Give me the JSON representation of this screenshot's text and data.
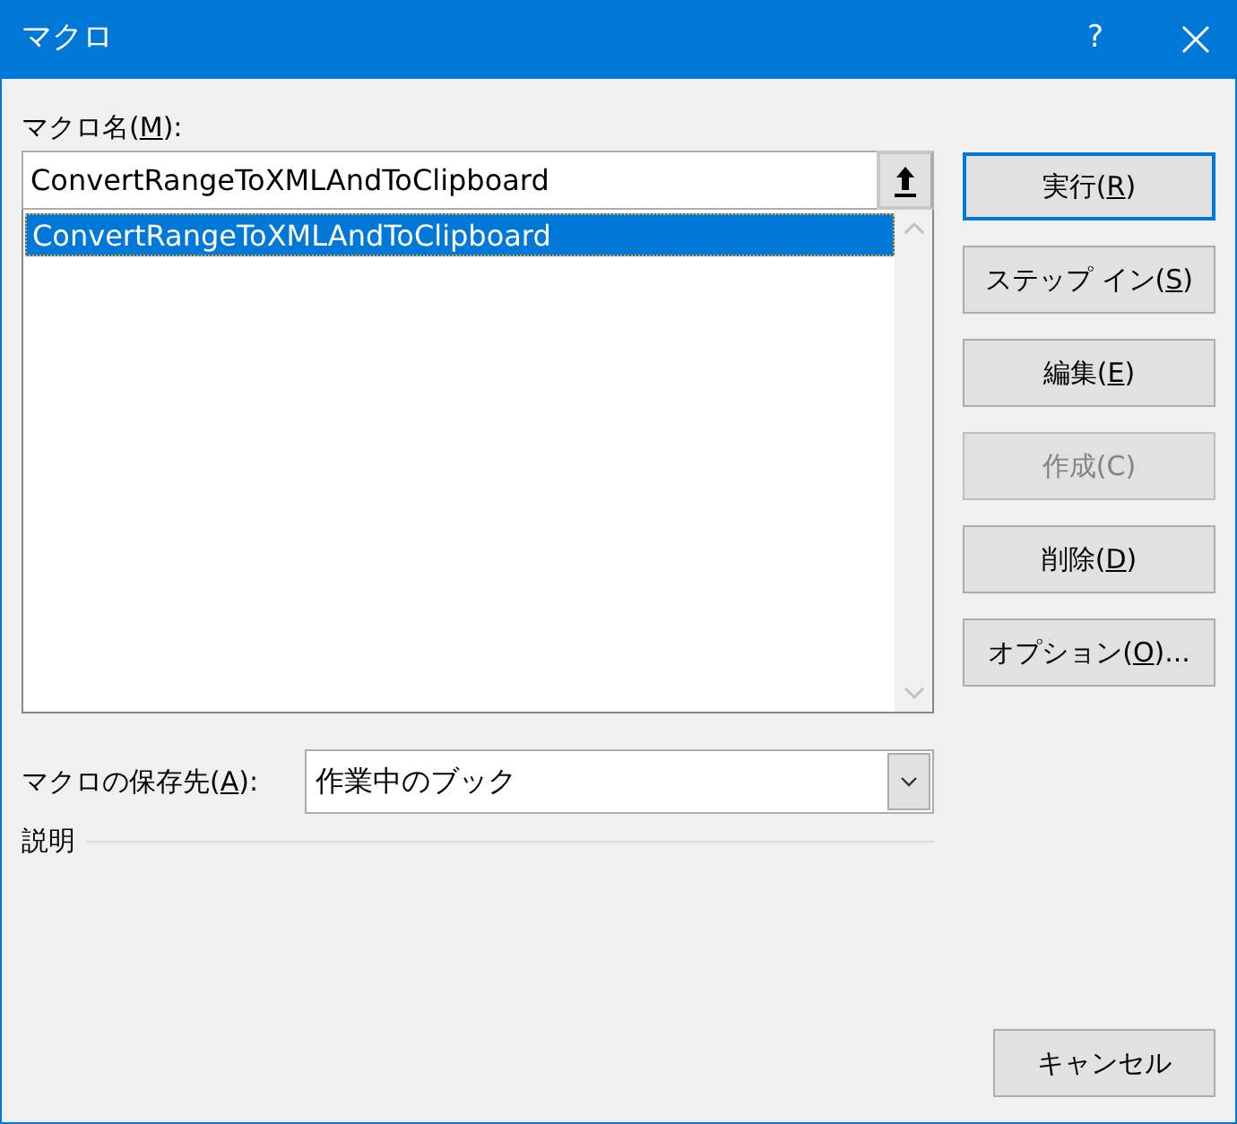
{
  "window": {
    "title": "マクロ",
    "help": "?"
  },
  "name_label": {
    "before": "マクロ名(",
    "key": "M",
    "after": "):"
  },
  "name_field": {
    "value": "ConvertRangeToXMLAndToClipboard"
  },
  "macro_list": [
    {
      "text": "ConvertRangeToXMLAndToClipboard",
      "selected": true
    }
  ],
  "buttons": [
    {
      "before": "実行(",
      "key": "R",
      "after": ")",
      "disabled": false,
      "default": true
    },
    {
      "before": "ステップ イン(",
      "key": "S",
      "after": ")",
      "disabled": false,
      "default": false
    },
    {
      "before": "編集(",
      "key": "E",
      "after": ")",
      "disabled": false,
      "default": false
    },
    {
      "before": "作成(C)",
      "disabled": true,
      "default": false
    },
    {
      "before": "削除(",
      "key": "D",
      "after": ")",
      "disabled": false,
      "default": false
    },
    {
      "before": "オプション(",
      "key": "O",
      "after": ")...",
      "disabled": false,
      "default": false
    }
  ],
  "store_label": {
    "before": "マクロの保存先(",
    "key": "A",
    "after": "):"
  },
  "store_dropdown": {
    "value": "作業中のブック"
  },
  "description_label": "説明",
  "cancel_button": "キャンセル"
}
